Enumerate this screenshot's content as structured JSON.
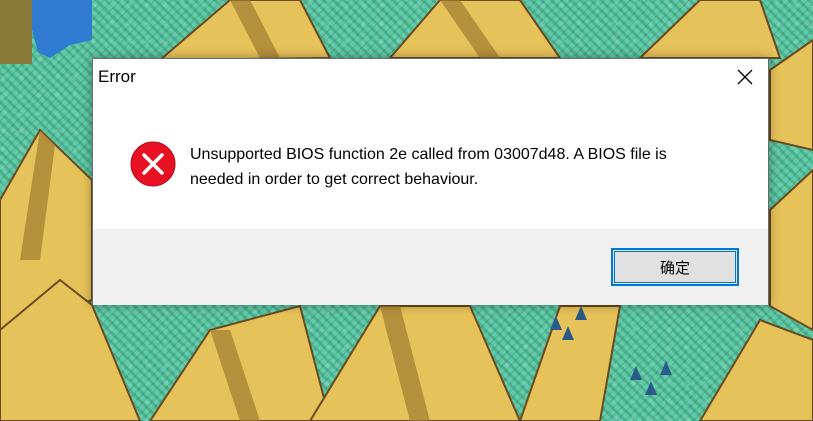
{
  "dialog": {
    "title": "Error",
    "message_line1": "Unsupported BIOS function 2e called from 03007d48. A BIOS file is",
    "message_line2": "needed in order to get correct behaviour.",
    "ok_label": "确定",
    "icon": "error-icon",
    "accent_color": "#0078d7",
    "error_color": "#e81123"
  }
}
